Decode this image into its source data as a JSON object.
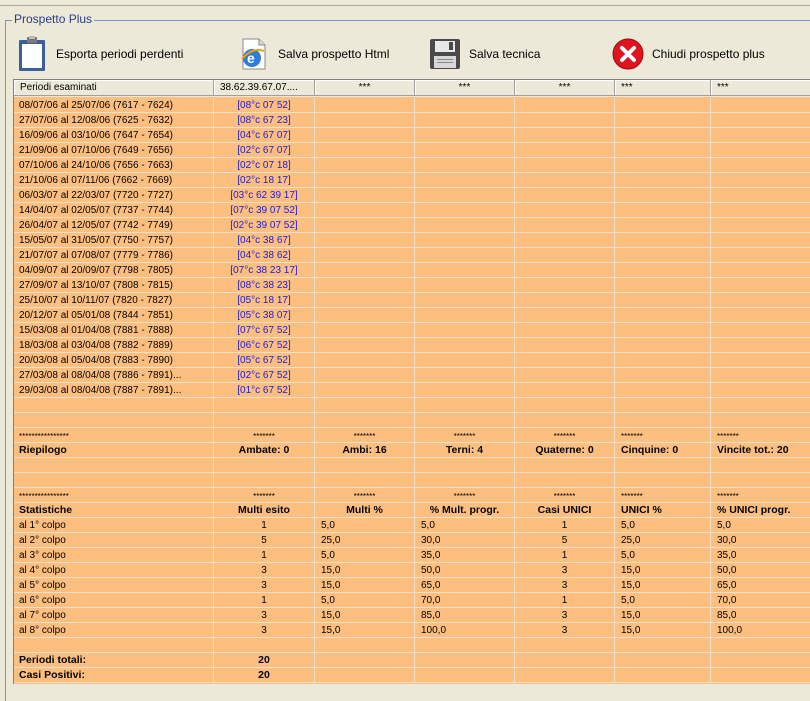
{
  "group_title": "Prospetto Plus",
  "toolbar": {
    "export_label": "Esporta periodi perdenti",
    "save_html_label": "Salva prospetto Html",
    "save_tech_label": "Salva tecnica",
    "close_label": "Chiudi prospetto plus"
  },
  "columns": [
    "Periodi esaminati",
    "38.62.39.67.07....",
    "***",
    "***",
    "***",
    "***",
    "***"
  ],
  "periods": [
    {
      "period": "08/07/06 al 25/07/06  (7617 - 7624)",
      "result": "[08°c 07 52]"
    },
    {
      "period": "27/07/06 al 12/08/06  (7625 - 7632)",
      "result": "[08°c 67 23]"
    },
    {
      "period": "16/09/06 al 03/10/06  (7647 - 7654)",
      "result": "[04°c 67 07]"
    },
    {
      "period": "21/09/06 al 07/10/06  (7649 - 7656)",
      "result": "[02°c 67 07]"
    },
    {
      "period": "07/10/06 al 24/10/06  (7656 - 7663)",
      "result": "[02°c 07 18]"
    },
    {
      "period": "21/10/06 al 07/11/06  (7662 - 7669)",
      "result": "[02°c 18 17]"
    },
    {
      "period": "06/03/07 al 22/03/07  (7720 - 7727)",
      "result": "[03°c 62 39 17]"
    },
    {
      "period": "14/04/07 al 02/05/07  (7737 - 7744)",
      "result": "[07°c 39 07 52]"
    },
    {
      "period": "26/04/07 al 12/05/07  (7742 - 7749)",
      "result": "[02°c 39 07 52]"
    },
    {
      "period": "15/05/07 al 31/05/07  (7750 - 7757)",
      "result": "[04°c 38 67]"
    },
    {
      "period": "21/07/07 al 07/08/07  (7779 - 7786)",
      "result": "[04°c 38 62]"
    },
    {
      "period": "04/09/07 al 20/09/07  (7798 - 7805)",
      "result": "[07°c 38 23 17]"
    },
    {
      "period": "27/09/07 al 13/10/07  (7808 - 7815)",
      "result": "[08°c 38 23]"
    },
    {
      "period": "25/10/07 al 10/11/07  (7820 - 7827)",
      "result": "[05°c 18 17]"
    },
    {
      "period": "20/12/07 al 05/01/08  (7844 - 7851)",
      "result": "[05°c 38 07]"
    },
    {
      "period": "15/03/08 al 01/04/08  (7881 - 7888)",
      "result": "[07°c 67 52]"
    },
    {
      "period": "18/03/08 al 03/04/08  (7882 - 7889)",
      "result": "[06°c 67 52]"
    },
    {
      "period": "20/03/08 al 05/04/08  (7883 - 7890)",
      "result": "[05°c 67 52]"
    },
    {
      "period": "27/03/08 al 08/04/08  (7886 - 7891)...",
      "result": "[02°c 67 52]"
    },
    {
      "period": "29/03/08 al 08/04/08  (7887 - 7891)...",
      "result": "[01°c 67 52]"
    }
  ],
  "stars_long": "****************",
  "stars_short": "*******",
  "summary": {
    "label": "Riepilogo",
    "values": [
      "Ambate: 0",
      "Ambi: 16",
      "Terni: 4",
      "Quaterne: 0",
      "Cinquine: 0",
      "Vincite tot.: 20"
    ]
  },
  "stats": {
    "label": "Statistiche",
    "headers": [
      "Multi esito",
      "Multi %",
      "% Mult. progr.",
      "Casi UNICI",
      "UNICI %",
      "% UNICI progr."
    ],
    "rows": [
      {
        "colpo": "al 1° colpo",
        "v": [
          "1",
          "5,0",
          "5,0",
          "1",
          "5,0",
          "5,0"
        ]
      },
      {
        "colpo": "al 2° colpo",
        "v": [
          "5",
          "25,0",
          "30,0",
          "5",
          "25,0",
          "30,0"
        ]
      },
      {
        "colpo": "al 3° colpo",
        "v": [
          "1",
          "5,0",
          "35,0",
          "1",
          "5,0",
          "35,0"
        ]
      },
      {
        "colpo": "al 4° colpo",
        "v": [
          "3",
          "15,0",
          "50,0",
          "3",
          "15,0",
          "50,0"
        ]
      },
      {
        "colpo": "al 5° colpo",
        "v": [
          "3",
          "15,0",
          "65,0",
          "3",
          "15,0",
          "65,0"
        ]
      },
      {
        "colpo": "al 6° colpo",
        "v": [
          "1",
          "5,0",
          "70,0",
          "1",
          "5,0",
          "70,0"
        ]
      },
      {
        "colpo": "al 7° colpo",
        "v": [
          "3",
          "15,0",
          "85,0",
          "3",
          "15,0",
          "85,0"
        ]
      },
      {
        "colpo": "al 8° colpo",
        "v": [
          "3",
          "15,0",
          "100,0",
          "3",
          "15,0",
          "100,0"
        ]
      }
    ]
  },
  "totals": [
    {
      "label": "Periodi totali:",
      "value": "20"
    },
    {
      "label": "Casi Positivi:",
      "value": "20"
    }
  ],
  "colors": {
    "grid_bg": "#fdbf80",
    "result_text": "#1a1adc",
    "close_icon": "#e0141e"
  },
  "icons": {
    "export": "clipboard-icon",
    "save_html": "ie-page-icon",
    "save_tech": "floppy-disk-icon",
    "close": "close-circle-icon"
  }
}
